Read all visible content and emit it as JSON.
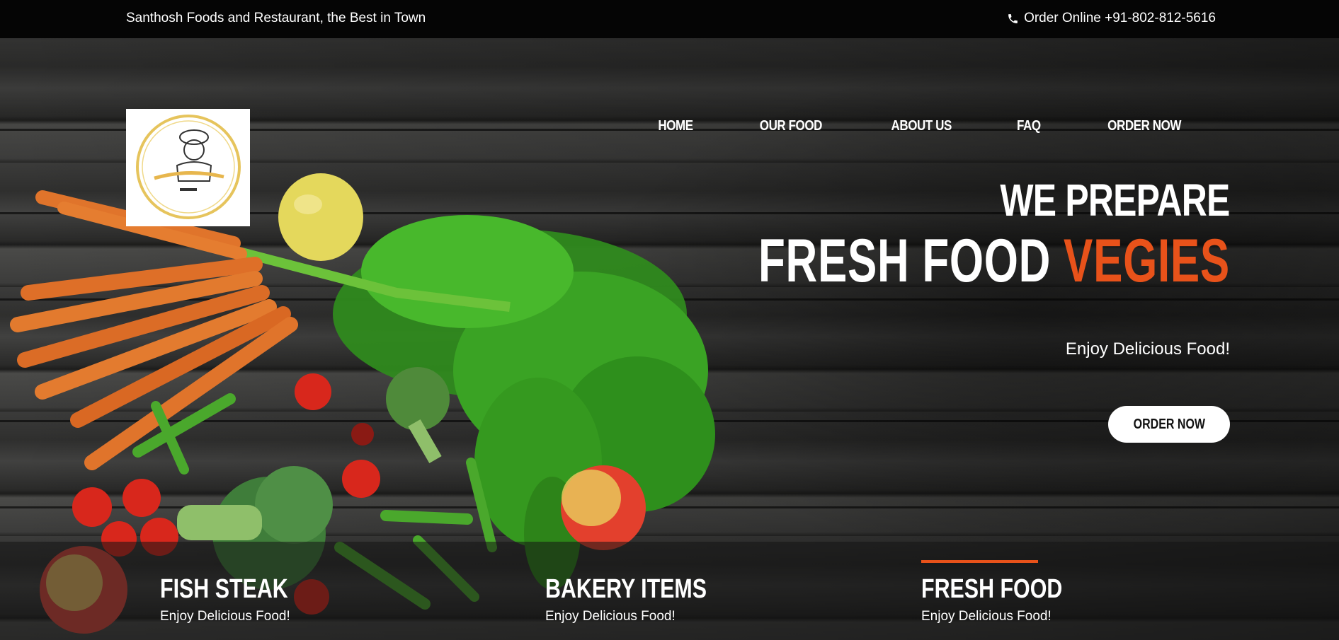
{
  "topbar": {
    "tagline": "Santhosh Foods and Restaurant, the Best in Town",
    "order_phone": "Order Online +91-802-812-5616",
    "phone_icon": "phone-icon"
  },
  "logo": {
    "alt": "Santosh dhaba Restaurant"
  },
  "nav": [
    {
      "label": "HOME"
    },
    {
      "label": "OUR FOOD"
    },
    {
      "label": "ABOUT US"
    },
    {
      "label": "FAQ"
    },
    {
      "label": "ORDER NOW"
    }
  ],
  "hero": {
    "line1": "WE PREPARE",
    "line2_main": "FRESH FOOD",
    "line2_accent": "VEGIES",
    "subtitle": "Enjoy Delicious Food!",
    "cta": "ORDER NOW"
  },
  "features": [
    {
      "title": "FISH STEAK",
      "desc": "Enjoy Delicious Food!"
    },
    {
      "title": "BAKERY ITEMS",
      "desc": "Enjoy Delicious Food!"
    },
    {
      "title": "FRESH FOOD",
      "desc": "Enjoy Delicious Food!",
      "active": true
    }
  ],
  "colors": {
    "accent": "#e8521a",
    "topbar": "#050505",
    "button": "#ffffff"
  }
}
